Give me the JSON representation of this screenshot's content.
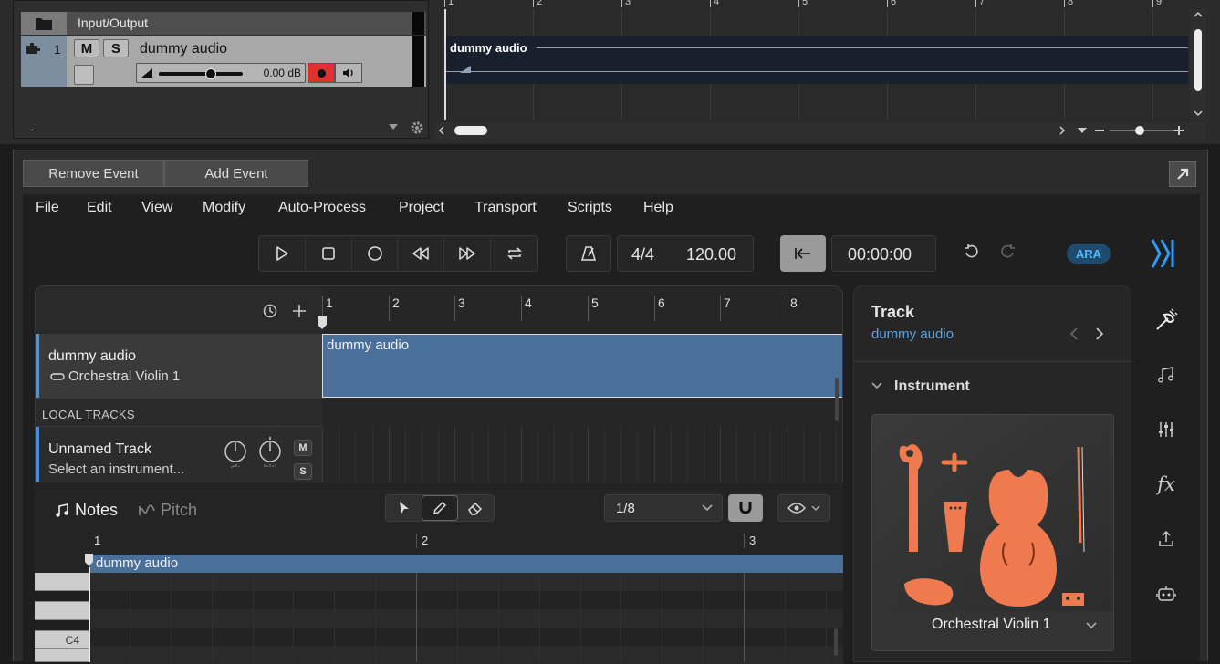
{
  "host": {
    "io_label": "Input/Output",
    "track": {
      "number": "1",
      "mute": "M",
      "solo": "S",
      "name": "dummy audio",
      "volume_db": "0.00 dB",
      "volume_level": 0.62
    },
    "bottom_dash": "-",
    "ruler_numbers": [
      "1",
      "2",
      "3",
      "4",
      "5",
      "6",
      "7",
      "8",
      "9"
    ],
    "clip_name": "dummy audio"
  },
  "plugin": {
    "remove_event": "Remove Event",
    "add_event": "Add Event",
    "menu": [
      "File",
      "Edit",
      "View",
      "Modify",
      "Auto-Process",
      "Project",
      "Transport",
      "Scripts",
      "Help"
    ],
    "time_signature": "4/4",
    "tempo": "120.00",
    "time_display": "00:00:00",
    "ara_label": "ARA",
    "arrangement": {
      "ruler_numbers": [
        "1",
        "2",
        "3",
        "4",
        "5",
        "6",
        "7",
        "8"
      ],
      "track_name": "dummy audio",
      "track_instrument": "Orchestral Violin 1",
      "clip_name": "dummy audio",
      "local_tracks_label": "LOCAL TRACKS",
      "unnamed_track_name": "Unnamed Track",
      "unnamed_track_sub": "Select an instrument...",
      "mute": "M",
      "solo": "S"
    },
    "pianoroll": {
      "tab_notes": "Notes",
      "tab_pitch": "Pitch",
      "quantize": "1/8",
      "ruler_numbers": [
        "1",
        "2",
        "3"
      ],
      "clip_name": "dummy audio",
      "key_label": "C4"
    },
    "inspector": {
      "title": "Track",
      "subtitle": "dummy audio",
      "section": "Instrument",
      "instrument_name": "Orchestral Violin 1"
    },
    "colors": {
      "accent_blue": "#5aa3e6",
      "clip_blue": "#4a6f99",
      "record_red": "#e03030",
      "violin_orange": "#f07a50"
    }
  }
}
